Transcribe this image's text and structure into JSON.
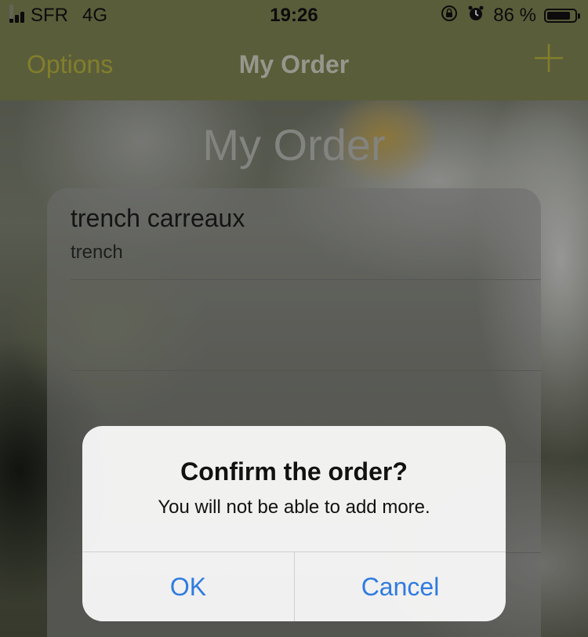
{
  "status_bar": {
    "carrier": "SFR",
    "network": "4G",
    "time": "19:26",
    "battery": "86 %",
    "battery_level": 0.86,
    "icons": [
      "signal-icon",
      "orientation-lock-icon",
      "alarm-icon",
      "battery-icon"
    ]
  },
  "nav": {
    "left_label": "Options",
    "title": "My Order",
    "right_icon": "plus-icon"
  },
  "page": {
    "title": "My Order"
  },
  "order": {
    "items": [
      {
        "name": "trench carreaux",
        "subtitle": "trench"
      },
      {
        "name": "",
        "subtitle": ""
      },
      {
        "name": "",
        "subtitle": ""
      },
      {
        "name": "",
        "subtitle": ""
      }
    ]
  },
  "alert": {
    "title": "Confirm the order?",
    "message": "You will not be able to add more.",
    "ok_label": "OK",
    "cancel_label": "Cancel"
  },
  "colors": {
    "nav_bg": "#7d8251",
    "accent": "#b5b13c",
    "alert_button": "#2f7be0"
  }
}
